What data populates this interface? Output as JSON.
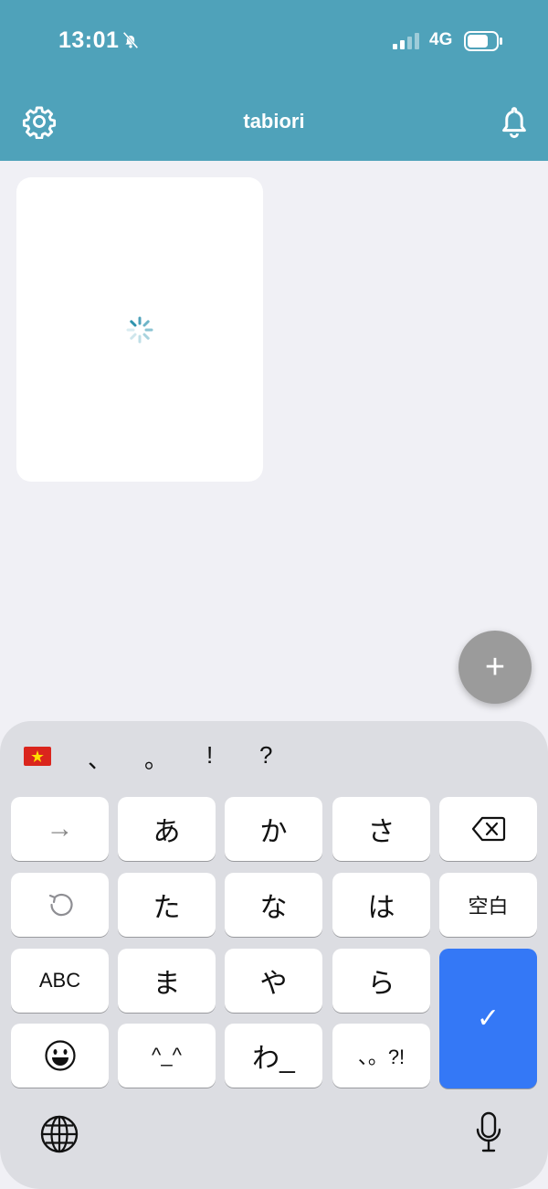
{
  "status_bar": {
    "time": "13:01",
    "network": "4G",
    "icons": [
      "bell-slash-icon",
      "signal-icon",
      "battery-icon"
    ]
  },
  "header": {
    "title": "tabiori",
    "left_icon": "gear-icon",
    "right_icon": "bell-icon",
    "background": "#4fa2ba"
  },
  "card": {
    "state": "loading",
    "icon": "spinner-icon"
  },
  "fab": {
    "label": "+"
  },
  "keyboard": {
    "suggestions": [
      "、",
      "。",
      "!",
      "?"
    ],
    "keys": {
      "arrow": "→",
      "a": "あ",
      "ka": "か",
      "sa": "さ",
      "ta": "た",
      "na": "な",
      "ha": "は",
      "space": "空白",
      "abc": "ABC",
      "ma": "ま",
      "ya": "や",
      "ra": "ら",
      "kaomoji": "^_^",
      "wa": "わ_",
      "punct": "、。?!",
      "done": "✓"
    },
    "accent_color": "#3478f6"
  }
}
